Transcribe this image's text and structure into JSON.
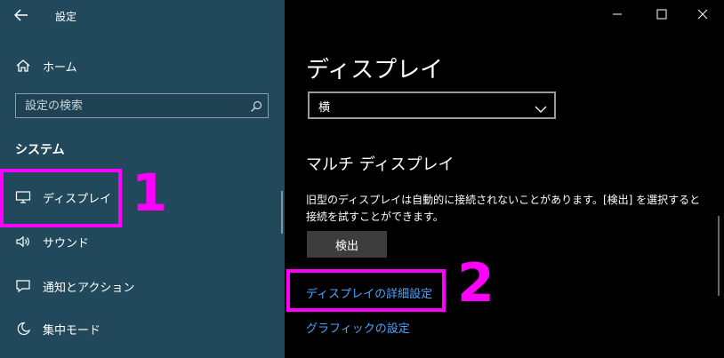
{
  "titlebar": {
    "title": "設定"
  },
  "sidebar": {
    "home_label": "ホーム",
    "search": {
      "placeholder": "設定の検索"
    },
    "section_label": "システム",
    "items": [
      {
        "label": "ディスプレイ",
        "icon": "monitor-icon"
      },
      {
        "label": "サウンド",
        "icon": "speaker-icon"
      },
      {
        "label": "通知とアクション",
        "icon": "notification-icon"
      },
      {
        "label": "集中モード",
        "icon": "moon-icon"
      }
    ]
  },
  "main": {
    "page_title": "ディスプレイ",
    "orientation_value": "横",
    "multi_display_heading": "マルチ ディスプレイ",
    "description_line1": "旧型のディスプレイは自動的に接続されないことがあります。[検出] を選択すると",
    "description_line2": "接続を試すことができます。",
    "detect_button": "検出",
    "advanced_link": "ディスプレイの詳細設定",
    "graphics_link": "グラフィックの設定"
  },
  "annotations": {
    "label1": "1",
    "label2": "2",
    "color": "#ff00ff"
  }
}
